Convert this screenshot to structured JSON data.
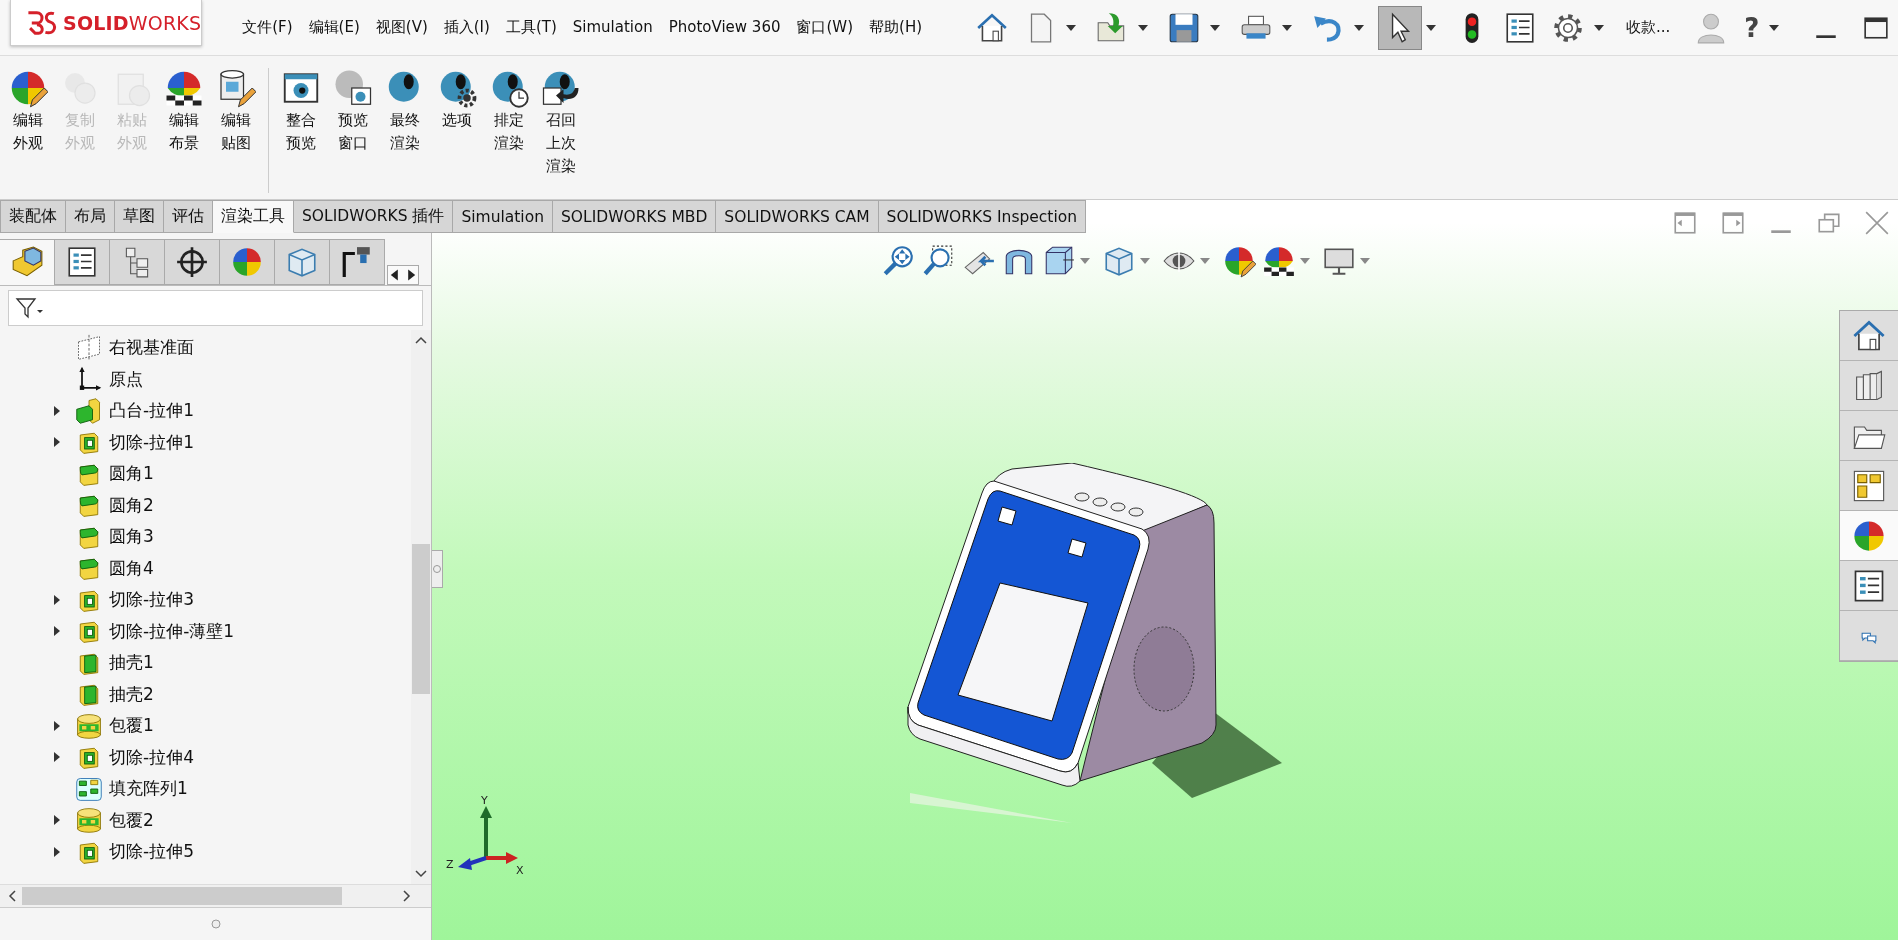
{
  "logo": {
    "text": "**SOLID**WORKS"
  },
  "menu": [
    "文件(F)",
    "编辑(E)",
    "视图(V)",
    "插入(I)",
    "工具(T)",
    "Simulation",
    "PhotoView 360",
    "窗口(W)",
    "帮助(H)"
  ],
  "quick_access": [
    {
      "kind": "home",
      "dropdown": false,
      "pressed": false
    },
    {
      "kind": "new",
      "dropdown": true,
      "pressed": false
    },
    {
      "kind": "open",
      "dropdown": true,
      "pressed": false
    },
    {
      "kind": "save",
      "dropdown": true,
      "pressed": false
    },
    {
      "kind": "print",
      "dropdown": true,
      "pressed": false
    },
    {
      "kind": "undo",
      "dropdown": true,
      "pressed": false
    },
    {
      "kind": "select",
      "dropdown": true,
      "pressed": true
    },
    {
      "kind": "rebuild",
      "dropdown": false,
      "pressed": false
    },
    {
      "kind": "properties",
      "dropdown": false,
      "pressed": false
    },
    {
      "kind": "options",
      "dropdown": true,
      "pressed": false
    }
  ],
  "search_label": "收款...",
  "help": "?",
  "ribbon": [
    {
      "items": [
        {
          "lines": [
            "编辑",
            "外观"
          ],
          "kind": "appearance",
          "disabled": false
        },
        {
          "lines": [
            "复制",
            "外观"
          ],
          "kind": "copy",
          "disabled": true
        },
        {
          "lines": [
            "粘贴",
            "外观"
          ],
          "kind": "paste",
          "disabled": true
        },
        {
          "lines": [
            "编辑",
            "布景"
          ],
          "kind": "scene",
          "disabled": false
        },
        {
          "lines": [
            "编辑",
            "贴图"
          ],
          "kind": "decal",
          "disabled": false
        }
      ]
    },
    {
      "items": [
        {
          "lines": [
            "整合",
            "预览"
          ],
          "kind": "integrated",
          "disabled": false
        },
        {
          "lines": [
            "预览",
            "窗口"
          ],
          "kind": "preview",
          "disabled": false
        },
        {
          "lines": [
            "最终",
            "渲染"
          ],
          "kind": "render",
          "disabled": false
        },
        {
          "lines": [
            "选项"
          ],
          "kind": "render-options",
          "disabled": false
        },
        {
          "lines": [
            "排定",
            "渲染"
          ],
          "kind": "schedule",
          "disabled": false
        },
        {
          "lines": [
            "召回",
            "上次",
            "渲染"
          ],
          "kind": "recall",
          "disabled": false
        }
      ]
    }
  ],
  "command_tabs": [
    {
      "label": "装配体",
      "selected": false
    },
    {
      "label": "布局",
      "selected": false
    },
    {
      "label": "草图",
      "selected": false
    },
    {
      "label": "评估",
      "selected": false
    },
    {
      "label": "渲染工具",
      "selected": true
    },
    {
      "label": "SOLIDWORKS 插件",
      "selected": false
    },
    {
      "label": "Simulation",
      "selected": false
    },
    {
      "label": "SOLIDWORKS MBD",
      "selected": false
    },
    {
      "label": "SOLIDWORKS CAM",
      "selected": false
    },
    {
      "label": "SOLIDWORKS Inspection",
      "selected": false
    }
  ],
  "panel": {
    "tabs": [
      {
        "kind": "part",
        "selected": true
      },
      {
        "kind": "properties",
        "selected": false
      },
      {
        "kind": "config",
        "selected": false
      },
      {
        "kind": "target",
        "selected": false
      },
      {
        "kind": "appearance-ball",
        "selected": false
      },
      {
        "kind": "display",
        "selected": false
      },
      {
        "kind": "cam",
        "selected": false
      }
    ],
    "tree": [
      {
        "label": "右视基准面",
        "kind": "plane",
        "collapsed": false
      },
      {
        "label": "原点",
        "kind": "origin",
        "collapsed": false
      },
      {
        "label": "凸台-拉伸1",
        "kind": "boss",
        "collapsed": true
      },
      {
        "label": "切除-拉伸1",
        "kind": "cut",
        "collapsed": true
      },
      {
        "label": "圆角1",
        "kind": "fillet",
        "collapsed": false
      },
      {
        "label": "圆角2",
        "kind": "fillet",
        "collapsed": false
      },
      {
        "label": "圆角3",
        "kind": "fillet",
        "collapsed": false
      },
      {
        "label": "圆角4",
        "kind": "fillet",
        "collapsed": false
      },
      {
        "label": "切除-拉伸3",
        "kind": "cut",
        "collapsed": true
      },
      {
        "label": "切除-拉伸-薄壁1",
        "kind": "cut",
        "collapsed": true
      },
      {
        "label": "抽壳1",
        "kind": "shell",
        "collapsed": false
      },
      {
        "label": "抽壳2",
        "kind": "shell",
        "collapsed": false
      },
      {
        "label": "包覆1",
        "kind": "wrap",
        "collapsed": true
      },
      {
        "label": "切除-拉伸4",
        "kind": "cut",
        "collapsed": true
      },
      {
        "label": "填充阵列1",
        "kind": "pattern",
        "collapsed": false
      },
      {
        "label": "包覆2",
        "kind": "wrap",
        "collapsed": true
      },
      {
        "label": "切除-拉伸5",
        "kind": "cut",
        "collapsed": true
      }
    ]
  },
  "viewport": {
    "toolbar": [
      {
        "kind": "zoom-fit",
        "dropdown": false
      },
      {
        "kind": "zoom-area",
        "dropdown": false
      },
      {
        "kind": "previous-view",
        "dropdown": false
      },
      {
        "kind": "section",
        "dropdown": false
      },
      {
        "kind": "orientation",
        "dropdown": true
      },
      {
        "kind": "display",
        "dropdown": true
      },
      {
        "kind": "eye",
        "dropdown": true
      },
      {
        "kind": "appearance",
        "dropdown": false
      },
      {
        "kind": "scene",
        "dropdown": true
      },
      {
        "kind": "monitor",
        "dropdown": true
      }
    ],
    "task_pane": [
      {
        "kind": "home",
        "selected": false
      },
      {
        "kind": "library",
        "selected": false
      },
      {
        "kind": "folder",
        "selected": false
      },
      {
        "kind": "palette",
        "selected": false
      },
      {
        "kind": "appearance-ball",
        "selected": true
      },
      {
        "kind": "properties",
        "selected": false
      },
      {
        "kind": "chat",
        "selected": false
      }
    ],
    "triad": {
      "x": "X",
      "y": "Y",
      "z": "Z"
    }
  }
}
